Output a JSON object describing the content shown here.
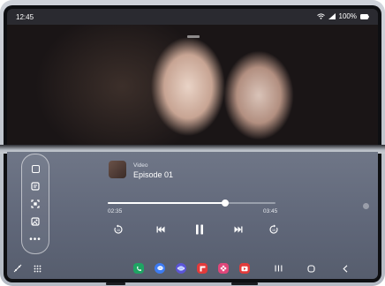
{
  "status": {
    "time": "12:45",
    "battery": "100%"
  },
  "media": {
    "type_label": "Video",
    "title": "Episode 01",
    "elapsed": "02:35",
    "total": "03:45",
    "progress_fraction": 0.7
  },
  "side_panel": {
    "icons": [
      "window-icon",
      "note-icon",
      "capture-icon",
      "gallery-icon",
      "more-icon"
    ]
  },
  "controls": [
    "replay-10-icon",
    "previous-icon",
    "pause-icon",
    "next-icon",
    "forward-10-icon"
  ],
  "taskbar": {
    "apps": [
      {
        "name": "phone-app-icon",
        "color": "#1fa463"
      },
      {
        "name": "messages-app-icon",
        "color": "#3d7bf2"
      },
      {
        "name": "internet-app-icon",
        "color": "#5b55d6"
      },
      {
        "name": "flipboard-app-icon",
        "color": "#e23b3b"
      },
      {
        "name": "flower-app-icon",
        "color": "#e0467a"
      },
      {
        "name": "video-app-icon",
        "color": "#e23b3b"
      }
    ]
  },
  "colors": {
    "accent": "#ffffff",
    "panel_bg": "#5f6678"
  }
}
